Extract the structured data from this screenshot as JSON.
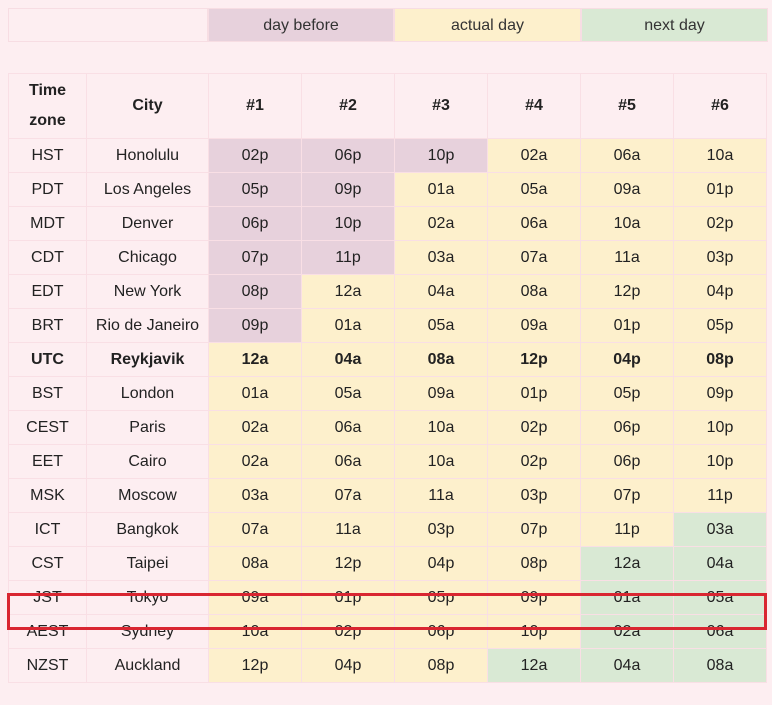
{
  "legend": {
    "day_before": "day before",
    "actual_day": "actual day",
    "next_day": "next day"
  },
  "headers": {
    "timezone_line1": "Time",
    "timezone_line2": "zone",
    "city": "City",
    "slots": [
      "#1",
      "#2",
      "#3",
      "#4",
      "#5",
      "#6"
    ]
  },
  "colors": {
    "day_before": "#e7d1dc",
    "actual_day": "#fdf0cc",
    "next_day": "#d9e9d4",
    "highlight": "#d92631"
  },
  "rows": [
    {
      "tz": "HST",
      "city": "Honolulu",
      "times": [
        "02p",
        "06p",
        "10p",
        "02a",
        "06a",
        "10a"
      ],
      "days": [
        "before",
        "before",
        "before",
        "actual",
        "actual",
        "actual"
      ]
    },
    {
      "tz": "PDT",
      "city": "Los Angeles",
      "times": [
        "05p",
        "09p",
        "01a",
        "05a",
        "09a",
        "01p"
      ],
      "days": [
        "before",
        "before",
        "actual",
        "actual",
        "actual",
        "actual"
      ]
    },
    {
      "tz": "MDT",
      "city": "Denver",
      "times": [
        "06p",
        "10p",
        "02a",
        "06a",
        "10a",
        "02p"
      ],
      "days": [
        "before",
        "before",
        "actual",
        "actual",
        "actual",
        "actual"
      ]
    },
    {
      "tz": "CDT",
      "city": "Chicago",
      "times": [
        "07p",
        "11p",
        "03a",
        "07a",
        "11a",
        "03p"
      ],
      "days": [
        "before",
        "before",
        "actual",
        "actual",
        "actual",
        "actual"
      ]
    },
    {
      "tz": "EDT",
      "city": "New York",
      "times": [
        "08p",
        "12a",
        "04a",
        "08a",
        "12p",
        "04p"
      ],
      "days": [
        "before",
        "actual",
        "actual",
        "actual",
        "actual",
        "actual"
      ]
    },
    {
      "tz": "BRT",
      "city": "Rio de Janeiro",
      "times": [
        "09p",
        "01a",
        "05a",
        "09a",
        "01p",
        "05p"
      ],
      "days": [
        "before",
        "actual",
        "actual",
        "actual",
        "actual",
        "actual"
      ]
    },
    {
      "tz": "UTC",
      "city": "Reykjavik",
      "times": [
        "12a",
        "04a",
        "08a",
        "12p",
        "04p",
        "08p"
      ],
      "days": [
        "actual",
        "actual",
        "actual",
        "actual",
        "actual",
        "actual"
      ],
      "bold": true
    },
    {
      "tz": "BST",
      "city": "London",
      "times": [
        "01a",
        "05a",
        "09a",
        "01p",
        "05p",
        "09p"
      ],
      "days": [
        "actual",
        "actual",
        "actual",
        "actual",
        "actual",
        "actual"
      ]
    },
    {
      "tz": "CEST",
      "city": "Paris",
      "times": [
        "02a",
        "06a",
        "10a",
        "02p",
        "06p",
        "10p"
      ],
      "days": [
        "actual",
        "actual",
        "actual",
        "actual",
        "actual",
        "actual"
      ]
    },
    {
      "tz": "EET",
      "city": "Cairo",
      "times": [
        "02a",
        "06a",
        "10a",
        "02p",
        "06p",
        "10p"
      ],
      "days": [
        "actual",
        "actual",
        "actual",
        "actual",
        "actual",
        "actual"
      ]
    },
    {
      "tz": "MSK",
      "city": "Moscow",
      "times": [
        "03a",
        "07a",
        "11a",
        "03p",
        "07p",
        "11p"
      ],
      "days": [
        "actual",
        "actual",
        "actual",
        "actual",
        "actual",
        "actual"
      ]
    },
    {
      "tz": "ICT",
      "city": "Bangkok",
      "times": [
        "07a",
        "11a",
        "03p",
        "07p",
        "11p",
        "03a"
      ],
      "days": [
        "actual",
        "actual",
        "actual",
        "actual",
        "actual",
        "next"
      ]
    },
    {
      "tz": "CST",
      "city": "Taipei",
      "times": [
        "08a",
        "12p",
        "04p",
        "08p",
        "12a",
        "04a"
      ],
      "days": [
        "actual",
        "actual",
        "actual",
        "actual",
        "next",
        "next"
      ]
    },
    {
      "tz": "JST",
      "city": "Tokyo",
      "times": [
        "09a",
        "01p",
        "05p",
        "09p",
        "01a",
        "05a"
      ],
      "days": [
        "actual",
        "actual",
        "actual",
        "actual",
        "next",
        "next"
      ],
      "highlighted": true
    },
    {
      "tz": "AEST",
      "city": "Sydney",
      "times": [
        "10a",
        "02p",
        "06p",
        "10p",
        "02a",
        "06a"
      ],
      "days": [
        "actual",
        "actual",
        "actual",
        "actual",
        "next",
        "next"
      ]
    },
    {
      "tz": "NZST",
      "city": "Auckland",
      "times": [
        "12p",
        "04p",
        "08p",
        "12a",
        "04a",
        "08a"
      ],
      "days": [
        "actual",
        "actual",
        "actual",
        "next",
        "next",
        "next"
      ]
    }
  ]
}
